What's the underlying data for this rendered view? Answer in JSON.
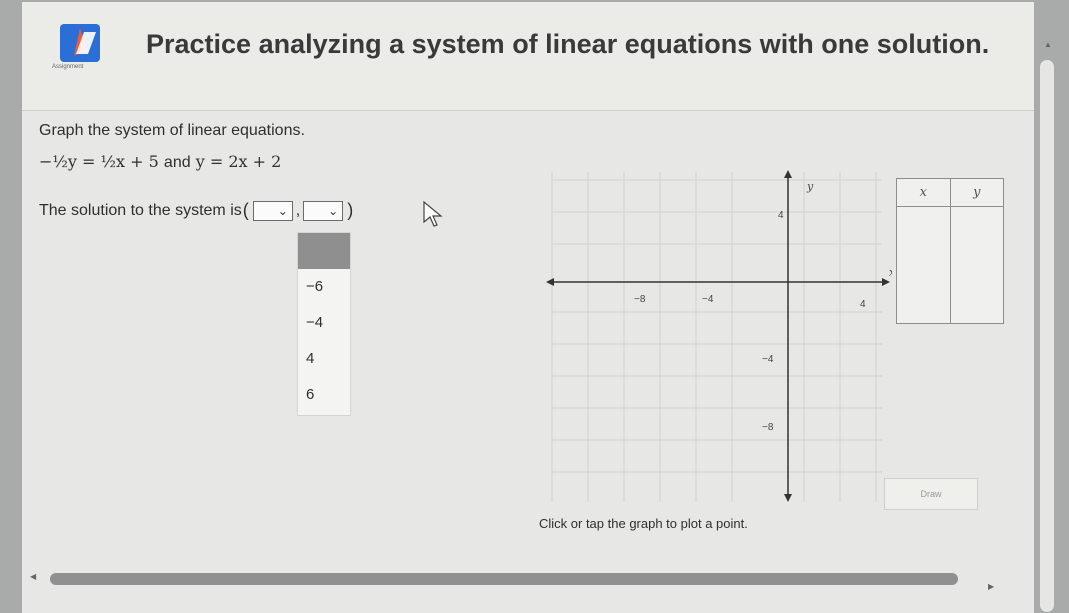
{
  "header": {
    "title": "Practice analyzing a system of linear equations with one solution.",
    "logo_caption": "Assignment"
  },
  "problem": {
    "instructions": "Graph the system of linear equations.",
    "eq1": "−½y = ½x + 5",
    "conjunction": "and",
    "eq2": "y = 2x + 2",
    "solution_prefix": "The solution to the system is",
    "open_paren": "(",
    "comma": ",",
    "close_paren": ")"
  },
  "dropdown": {
    "options": [
      "−6",
      "−4",
      "4",
      "6"
    ]
  },
  "graph": {
    "x_label": "x",
    "y_label": "y",
    "x_ticks": [
      "−8",
      "−4",
      "4"
    ],
    "y_ticks": [
      "4",
      "−4",
      "−8"
    ],
    "caption": "Click or tap the graph to plot a point."
  },
  "xy_table": {
    "col_x": "x",
    "col_y": "y"
  },
  "draw_button": "Draw",
  "icons": [
    "chevron-down-icon",
    "cursor-arrow-icon",
    "scroll-up-icon",
    "scroll-left-icon",
    "scroll-right-icon"
  ]
}
